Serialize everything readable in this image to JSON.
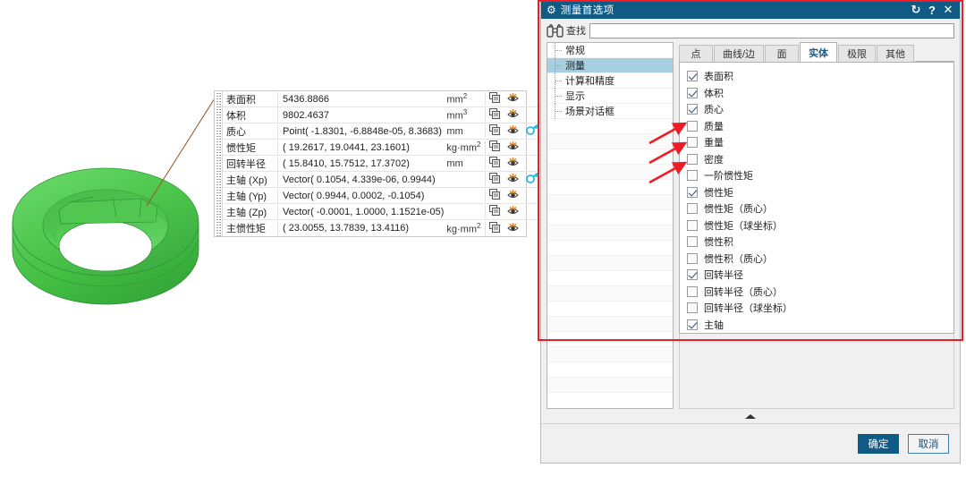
{
  "dialog": {
    "title": "测量首选项",
    "titlebar_buttons": [
      {
        "name": "reset-icon",
        "glyph": "↻"
      },
      {
        "name": "help-icon",
        "glyph": "?"
      },
      {
        "name": "close-icon",
        "glyph": "✕"
      }
    ],
    "search": {
      "label": "查找",
      "value": "",
      "placeholder": "",
      "icon": "binoculars-icon"
    },
    "tree": {
      "items": [
        {
          "label": "常规",
          "selected": false
        },
        {
          "label": "测量",
          "selected": true
        },
        {
          "label": "计算和精度",
          "selected": false
        },
        {
          "label": "显示",
          "selected": false
        },
        {
          "label": "场景对话框",
          "selected": false
        }
      ]
    },
    "tabs": [
      {
        "label": "点",
        "active": false
      },
      {
        "label": "曲线/边",
        "active": false
      },
      {
        "label": "面",
        "active": false
      },
      {
        "label": "实体",
        "active": true
      },
      {
        "label": "极限",
        "active": false
      },
      {
        "label": "其他",
        "active": false
      }
    ],
    "checkboxes": [
      {
        "label": "表面积",
        "checked": true
      },
      {
        "label": "体积",
        "checked": true
      },
      {
        "label": "质心",
        "checked": true
      },
      {
        "label": "质量",
        "checked": false
      },
      {
        "label": "重量",
        "checked": false
      },
      {
        "label": "密度",
        "checked": false
      },
      {
        "label": "一阶惯性矩",
        "checked": false
      },
      {
        "label": "惯性矩",
        "checked": true
      },
      {
        "label": "惯性矩（质心）",
        "checked": false
      },
      {
        "label": "惯性矩（球坐标）",
        "checked": false
      },
      {
        "label": "惯性积",
        "checked": false
      },
      {
        "label": "惯性积（质心）",
        "checked": false
      },
      {
        "label": "回转半径",
        "checked": true
      },
      {
        "label": "回转半径（质心）",
        "checked": false
      },
      {
        "label": "回转半径（球坐标）",
        "checked": false
      },
      {
        "label": "主轴",
        "checked": true
      }
    ],
    "buttons": {
      "ok": "确定",
      "cancel": "取消"
    },
    "collapse_arrow": "collapse-up-arrow-icon"
  },
  "measure_table": {
    "rows": [
      {
        "label": "表面积",
        "value": "5436.8866",
        "unit": "mm",
        "unit_sup": "2",
        "icons": [
          "copy-icon",
          "eye-icon"
        ]
      },
      {
        "label": "体积",
        "value": "9802.4637",
        "unit": "mm",
        "unit_sup": "3",
        "icons": [
          "copy-icon",
          "eye-icon"
        ]
      },
      {
        "label": "质心",
        "value": "Point( -1.8301, -6.8848e-05, 8.3683)",
        "unit": "mm",
        "unit_sup": "",
        "icons": [
          "copy-icon",
          "eye-icon",
          "locate-icon"
        ]
      },
      {
        "label": "惯性矩",
        "value": "( 19.2617, 19.0441, 23.1601)",
        "unit": "kg·mm",
        "unit_sup": "2",
        "icons": [
          "copy-icon",
          "eye-icon"
        ]
      },
      {
        "label": "回转半径",
        "value": "( 15.8410, 15.7512, 17.3702)",
        "unit": "mm",
        "unit_sup": "",
        "icons": [
          "copy-icon",
          "eye-icon"
        ]
      },
      {
        "label": "主轴 (Xp)",
        "value": "Vector( 0.1054, 4.339e-06, 0.9944)",
        "unit": "",
        "unit_sup": "",
        "icons": [
          "copy-icon",
          "eye-icon",
          "locate-icon"
        ]
      },
      {
        "label": "主轴 (Yp)",
        "value": "Vector( 0.9944, 0.0002, -0.1054)",
        "unit": "",
        "unit_sup": "",
        "icons": [
          "copy-icon",
          "eye-icon"
        ]
      },
      {
        "label": "主轴 (Zp)",
        "value": "Vector( -0.0001, 1.0000, 1.1521e-05)",
        "unit": "",
        "unit_sup": "",
        "icons": [
          "copy-icon",
          "eye-icon"
        ]
      },
      {
        "label": "主惯性矩",
        "value": "( 23.0055, 13.7839, 13.4116)",
        "unit": "kg·mm",
        "unit_sup": "2",
        "icons": [
          "copy-icon",
          "eye-icon"
        ]
      }
    ]
  },
  "model": {
    "name": "green-ring-solid",
    "color": "#4cc24c"
  },
  "annotations": {
    "highlight_rect_color": "#ee1c24",
    "arrow_color": "#ee1c24",
    "arrow_targets": [
      "质量",
      "重量",
      "密度"
    ]
  },
  "colors": {
    "title_bar": "#0f5b85",
    "tree_selection": "#a8cfe0",
    "ok_button": "#0f5b85",
    "eye_icon": "#f08a1e",
    "locate_icon": "#2bb8e0",
    "leader_line": "#9a5b2a"
  }
}
